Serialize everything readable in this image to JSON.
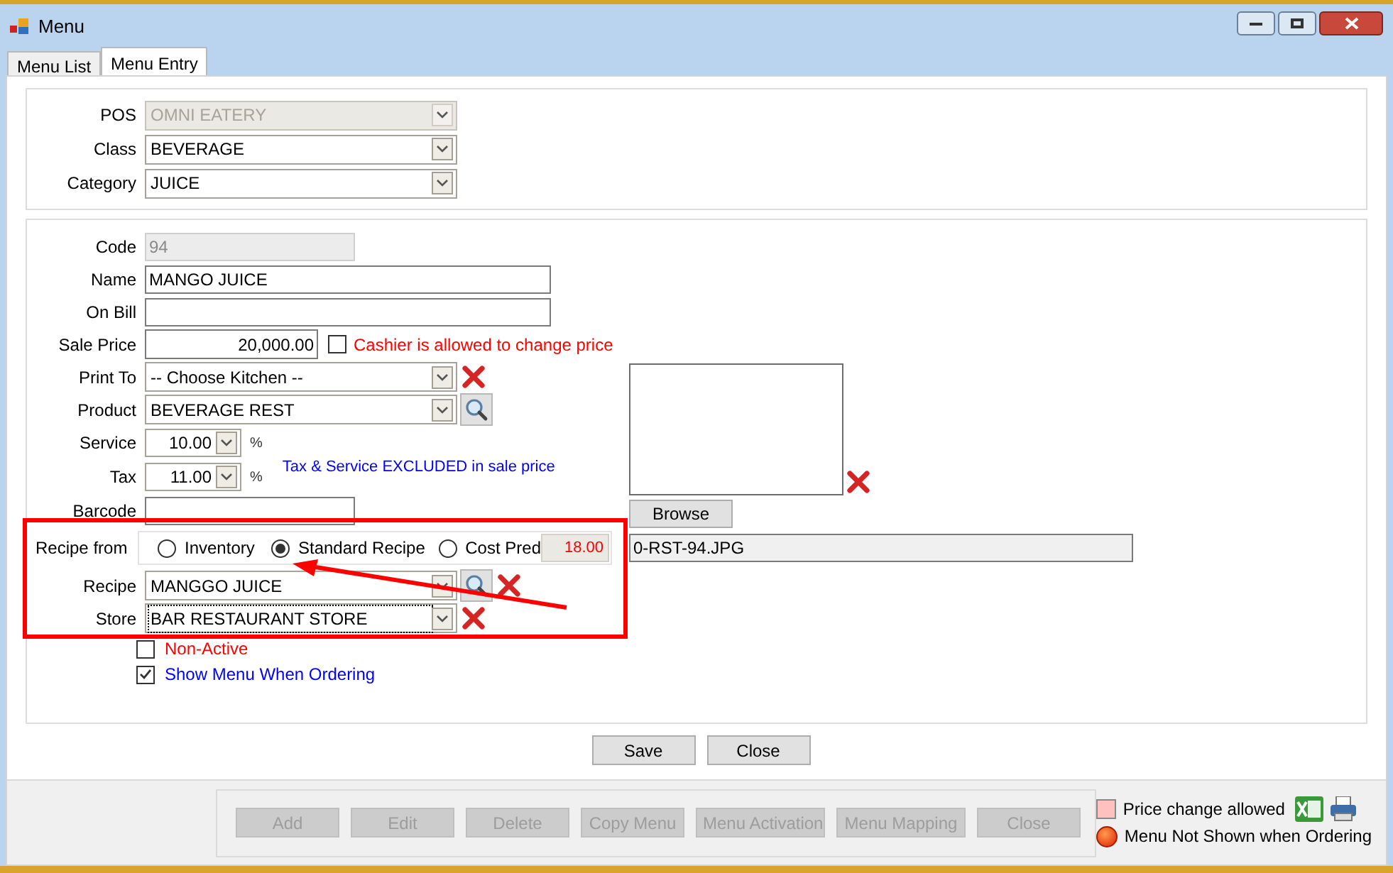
{
  "window": {
    "title": "Menu"
  },
  "tabs": [
    {
      "label": "Menu List",
      "selected": false
    },
    {
      "label": "Menu Entry",
      "selected": true
    }
  ],
  "header_fields": [
    {
      "label": "POS",
      "value": "OMNI EATERY",
      "disabled": true
    },
    {
      "label": "Class",
      "value": "BEVERAGE",
      "disabled": false
    },
    {
      "label": "Category",
      "value": "JUICE",
      "disabled": false
    }
  ],
  "fields": [
    {
      "kind": "text",
      "label": "Code",
      "value": "94",
      "disabled": true,
      "wide": false
    },
    {
      "kind": "text",
      "label": "Name",
      "value": "MANGO JUICE",
      "disabled": false,
      "wide": true
    },
    {
      "kind": "text",
      "label": "On Bill",
      "disabled": false,
      "wide": true
    },
    {
      "kind": "price",
      "label": "Sale Price",
      "value": "20,000.00",
      "checkbox": {
        "label": "Cashier is allowed to change price",
        "checked": false
      }
    },
    {
      "kind": "combo",
      "label": "Print To",
      "value": "-- Choose Kitchen --",
      "search": false,
      "clear": true,
      "focused": false
    },
    {
      "kind": "combo",
      "label": "Product",
      "value": "BEVERAGE REST",
      "search": true,
      "clear": false,
      "focused": false
    },
    {
      "kind": "percent",
      "label": "Service",
      "value": "10.00",
      "unit": "%"
    },
    {
      "kind": "percent",
      "label": "Tax",
      "value": "11.00",
      "unit": "%"
    },
    {
      "kind": "text",
      "label": "Barcode",
      "disabled": false,
      "wide": false
    },
    {
      "kind": "radio",
      "label": "Recipe from",
      "options": [
        {
          "label": "Inventory",
          "selected": false
        },
        {
          "label": "Standard Recipe",
          "selected": true
        },
        {
          "label": "Cost Pred",
          "selected": false
        }
      ],
      "cost": "18.00"
    },
    {
      "kind": "combo",
      "label": "Recipe",
      "value": "MANGGO JUICE",
      "search": true,
      "clear": true,
      "focused": false
    },
    {
      "kind": "combo",
      "label": "Store",
      "value": "BAR RESTAURANT STORE",
      "search": false,
      "clear": true,
      "focused": true
    }
  ],
  "note": "Tax & Service EXCLUDED in sale price",
  "checkboxes": [
    {
      "label": "Non-Active",
      "checked": false,
      "color": "#ff0000"
    },
    {
      "label": "Show Menu When Ordering",
      "checked": true,
      "color": "#0000ff"
    }
  ],
  "image": {
    "browse": "Browse",
    "file": "0-RST-94.JPG"
  },
  "actions": [
    "Save",
    "Close"
  ],
  "toolbar": [
    {
      "label": "Add",
      "disabled": true
    },
    {
      "label": "Edit",
      "disabled": true
    },
    {
      "label": "Delete",
      "disabled": true
    },
    {
      "label": "Copy Menu",
      "disabled": true
    },
    {
      "label": "Menu Activation",
      "disabled": true
    },
    {
      "label": "Menu Mapping",
      "disabled": true
    },
    {
      "label": "Close",
      "disabled": true
    }
  ],
  "legend": [
    {
      "kind": "square",
      "label": "Price change allowed"
    },
    {
      "kind": "dot",
      "label": "Menu Not Shown when Ordering"
    }
  ]
}
